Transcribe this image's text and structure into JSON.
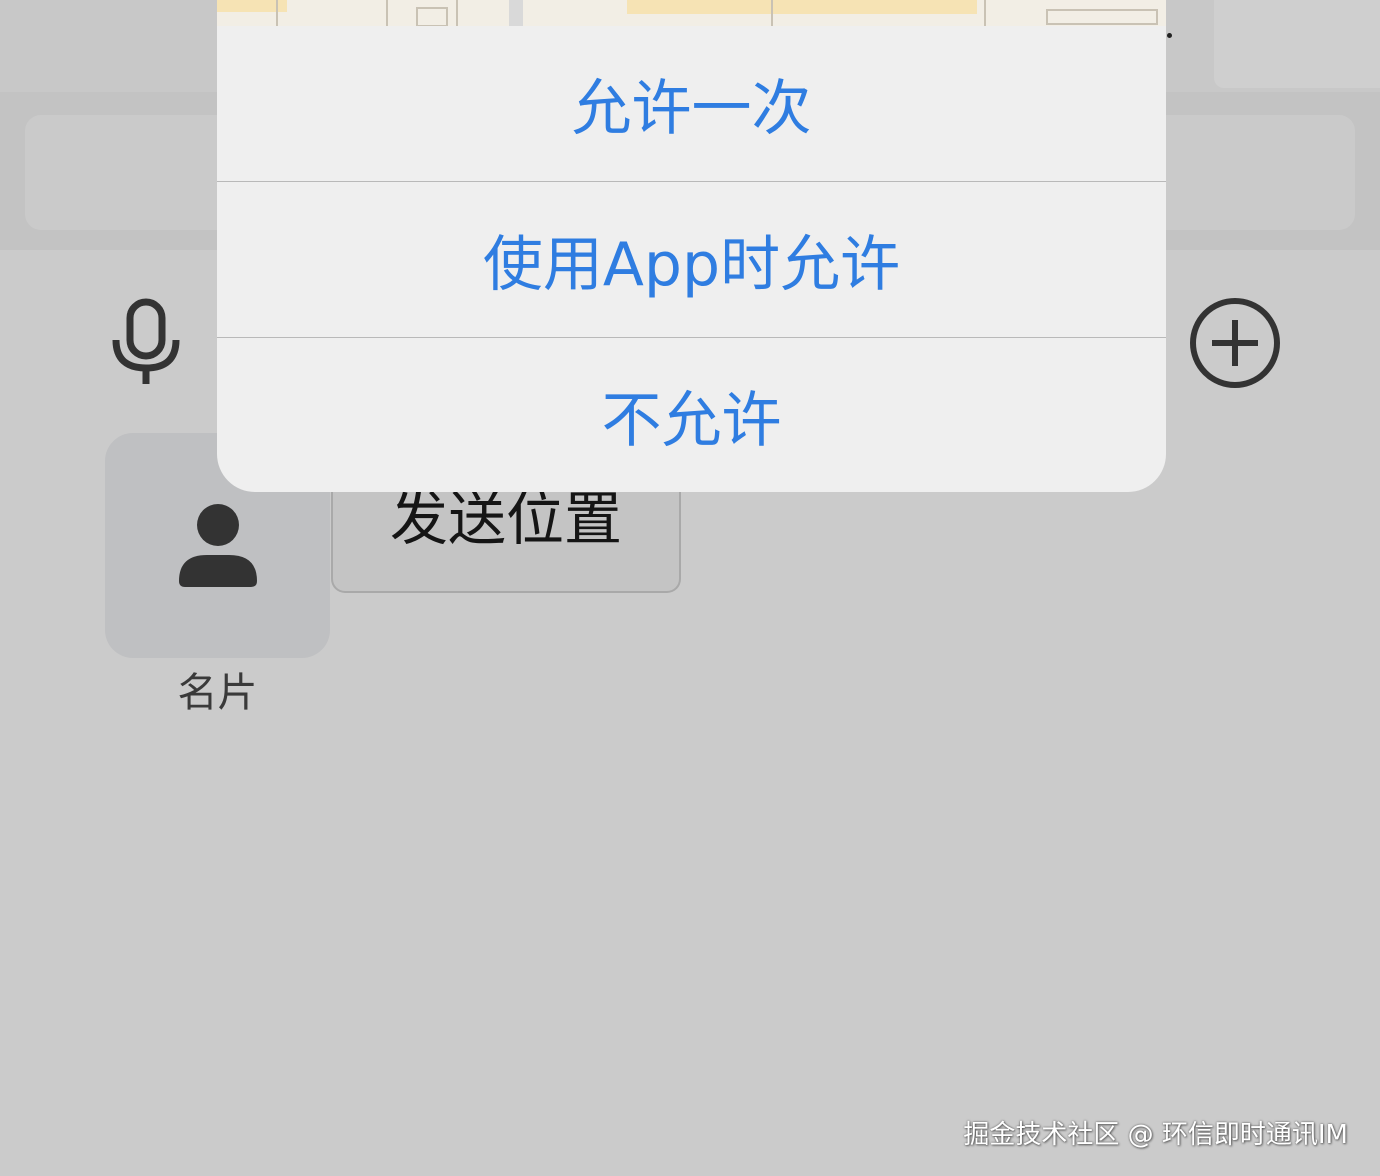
{
  "permission_sheet": {
    "allow_once_label": "允许一次",
    "allow_while_using_label": "使用App时允许",
    "deny_label": "不允许"
  },
  "extension_panel": {
    "contact_card_label": "名片",
    "send_location_label": "发送位置"
  },
  "watermark": {
    "text": "掘金技术社区 @ 环信即时通讯IM"
  },
  "colors": {
    "sheet_button_text": "#2f7de1",
    "sheet_background": "#efefef",
    "dimmed_background": "#cbcbcb"
  },
  "icons": {
    "microphone": "microphone-icon",
    "plus": "plus-circle-icon",
    "person": "person-icon"
  }
}
